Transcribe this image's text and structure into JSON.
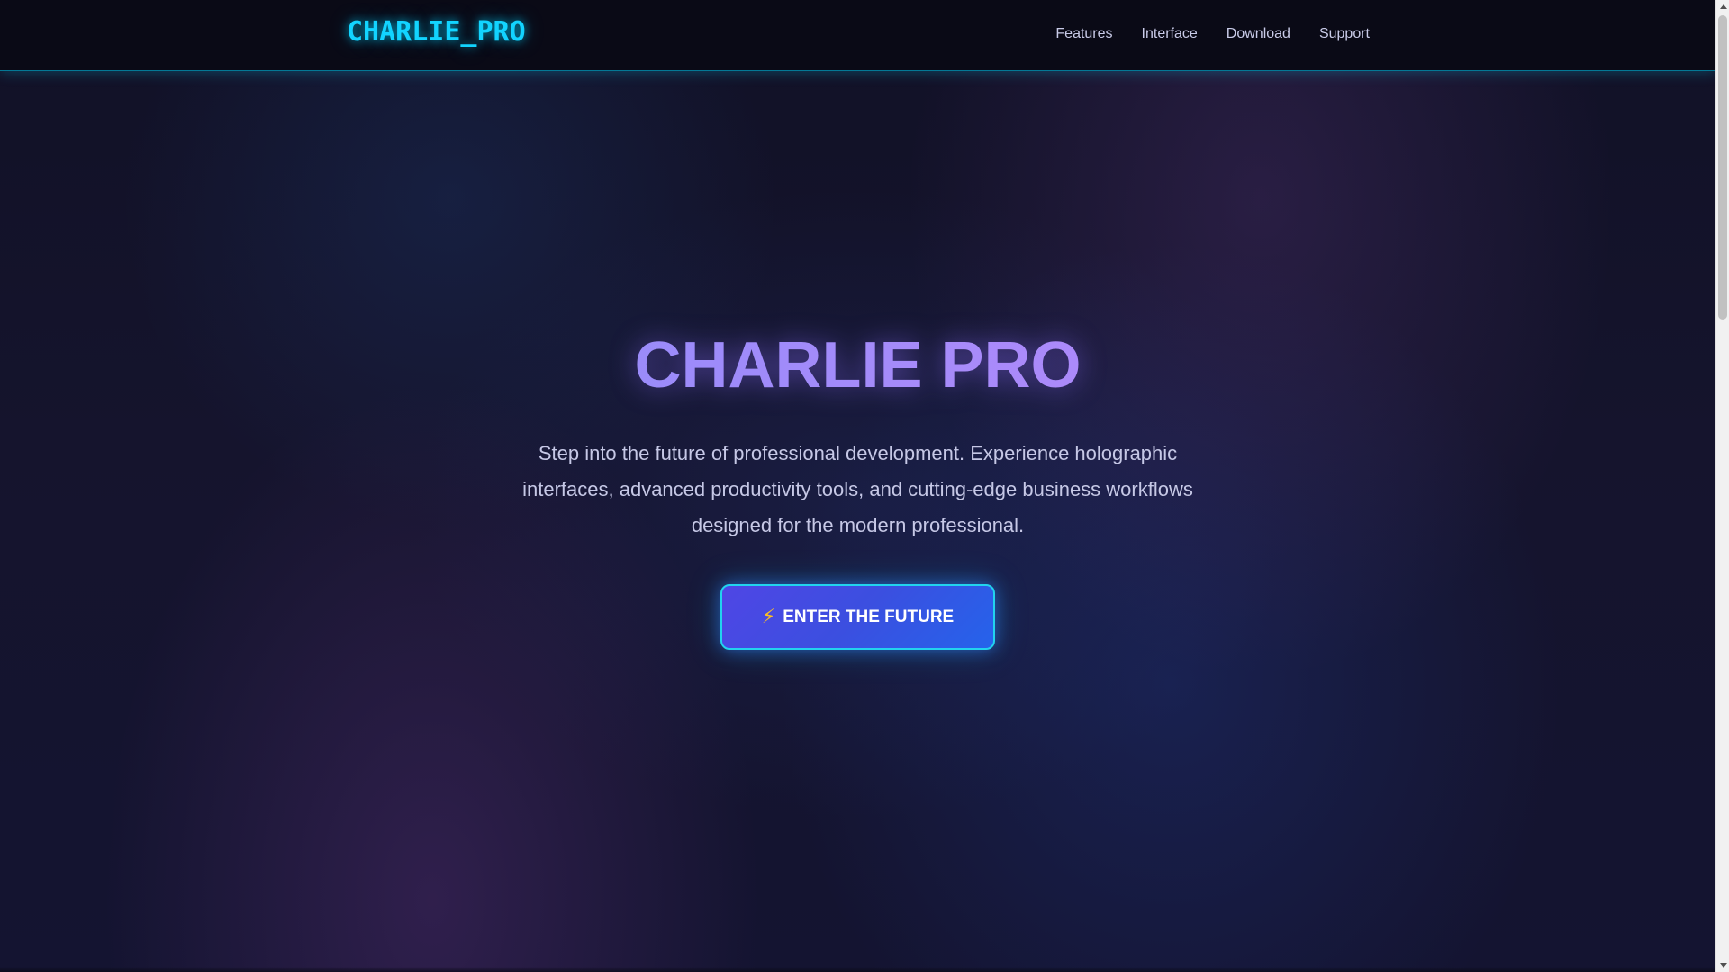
{
  "header": {
    "logo": "CHARLIE_PRO",
    "nav": [
      {
        "label": "Features"
      },
      {
        "label": "Interface"
      },
      {
        "label": "Download"
      },
      {
        "label": "Support"
      }
    ]
  },
  "hero": {
    "title": "CHARLIE PRO",
    "subtitle": "Step into the future of professional development. Experience holographic interfaces, advanced productivity tools, and cutting-edge business workflows designed for the modern professional.",
    "cta": {
      "icon": "lightning-bolt-icon",
      "glyph": "⚡",
      "label": "ENTER THE FUTURE"
    }
  },
  "colors": {
    "accent_cyan": "#12d4ff",
    "title_gradient_start": "#818cf8",
    "title_gradient_end": "#c084fc",
    "button_gradient_start": "#4f46e5",
    "button_gradient_end": "#2563eb",
    "background": "#141431"
  }
}
